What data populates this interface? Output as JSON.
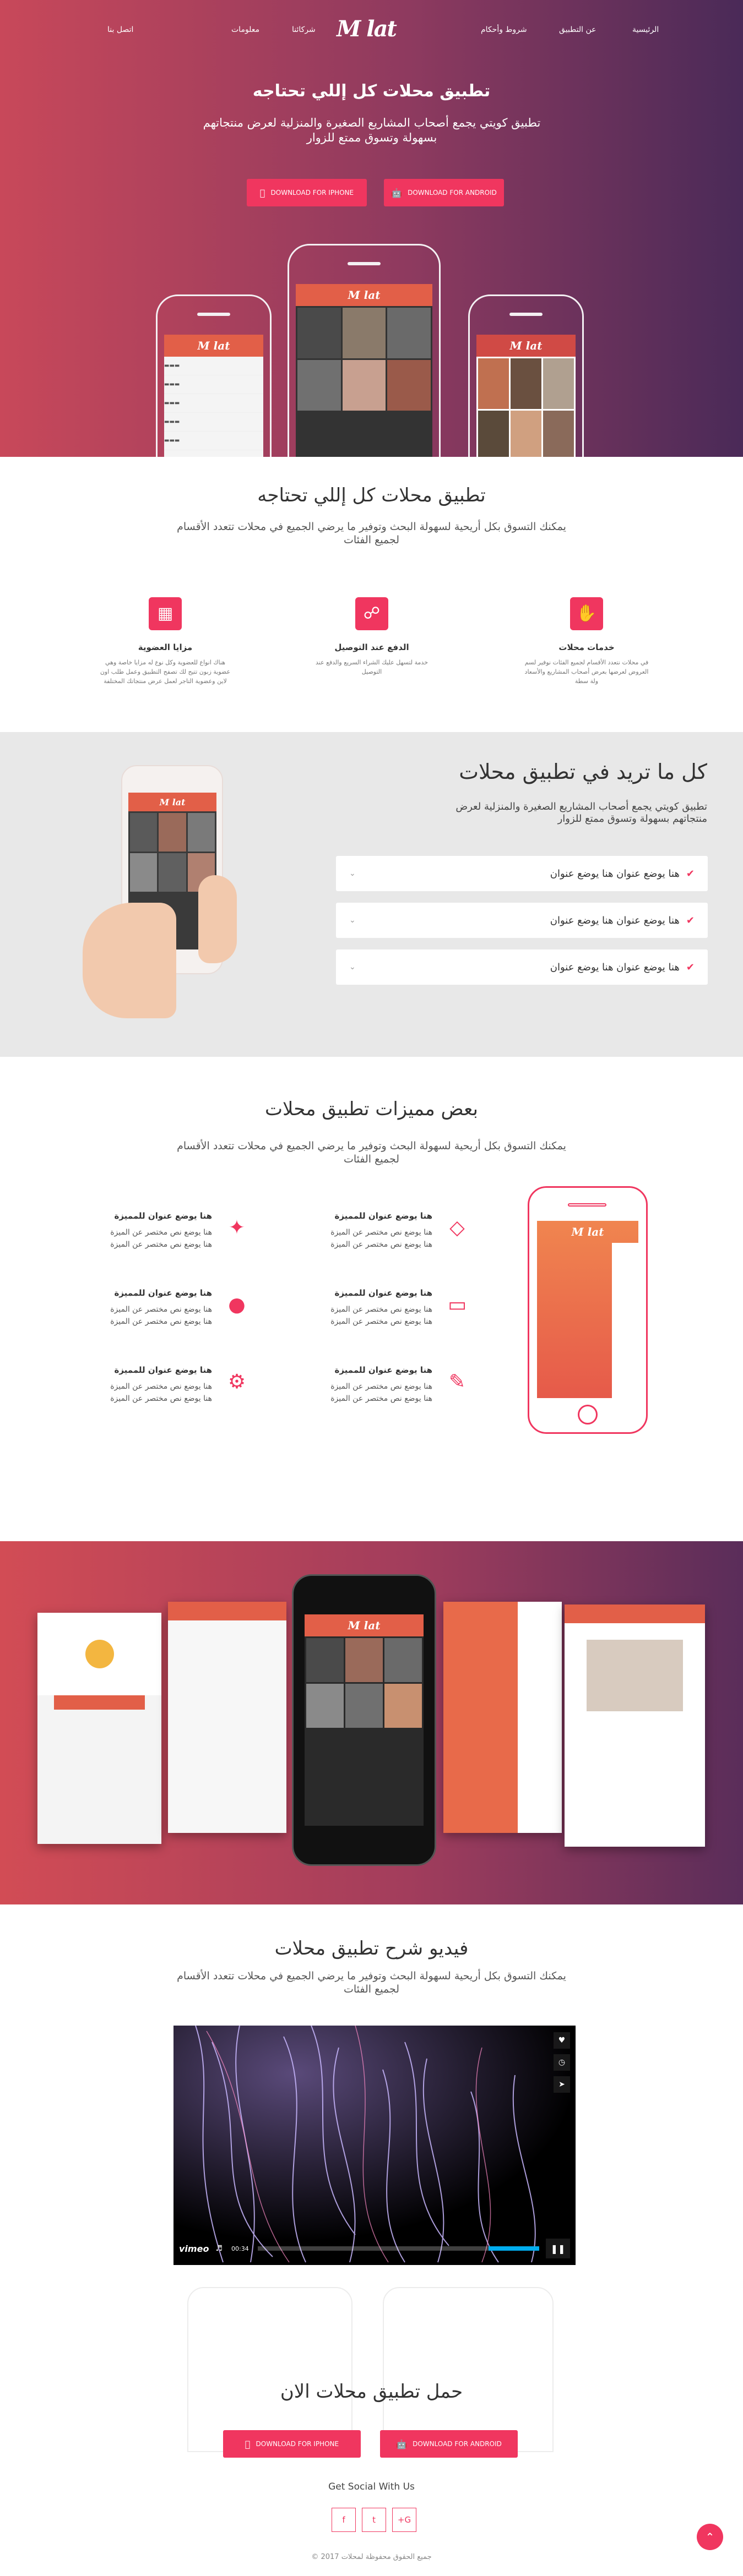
{
  "nav": {
    "logo": "M lat",
    "items": [
      "الرئيسية",
      "عن التطبيق",
      "شروط وأحكام",
      "شركائنا",
      "معلومات",
      "اتصل بنا"
    ]
  },
  "hero": {
    "title": "تطبيق محلات كل إللي تحتاجه",
    "subtitle": "تطبيق كويتي يجمع أصحاب المشاريع الصغيرة والمنزلية لعرض منتجاتهم بسهولة وتسوق ممتع للزوار",
    "btn_iphone": "DOWNLOAD FOR IPHONE",
    "btn_android": "DOWNLOAD FOR ANDROID"
  },
  "features": {
    "title": "تطبيق محلات كل إللي تحتاجه",
    "subtitle": "يمكنك التسوق بكل أريحية لسهولة البحث وتوفير ما يرضي الجميع في محلات تتعدد الأقسام لجميع الفئات",
    "items": [
      {
        "title": "خدمات محلات",
        "desc": "في محلات نتعدد الأقسام لجميع الفئات نوفير لسم العروض لعرضها بعرض أصحاب المشاريع والأسعاد ولة سطة",
        "icon": "hand-icon"
      },
      {
        "title": "الدفع عند التوصيل",
        "desc": "خدمة لتسهل عليك الشراء السريع والدفع عند التوصيل",
        "icon": "wallet-icon"
      },
      {
        "title": "مزايا العضوية",
        "desc": "هناك انواع للعضوية وكل نوع له مزايا خاصة وهي عضوية زبون تتيح لك تصفح التطبيق وعمل طلب اون لاين وعضوية التاجر لعمل عرض منتجاتك المختلفة",
        "icon": "grid-icon"
      }
    ]
  },
  "want": {
    "title": "كل ما تريد في تطبيق محلات",
    "subtitle": "تطبيق كويتي يجمع أصحاب المشاريع الصغيرة والمنزلية لعرض منتجاتهم بسهولة وتسوق ممتع للزوار",
    "accordion": [
      "هنا يوضع عنوان هنا يوضع عنوان",
      "هنا يوضع عنوان هنا يوضع عنوان",
      "هنا يوضع عنوان هنا يوضع عنوان"
    ]
  },
  "props": {
    "title": "بعض مميزات تطبيق محلات",
    "subtitle": "يمكنك التسوق بكل أريحية لسهولة البحث وتوفير ما يرضي الجميع في محلات تتعدد الأقسام لجميع الفئات",
    "items": [
      {
        "title": "هنا يوضع عنوان للمميزة",
        "desc": "هنا يوضع نص مختصر عن الميزة هنا يوضع نص مختصر عن الميزة",
        "icon": "diamond-icon"
      },
      {
        "title": "هنا يوضع عنوان للمميزة",
        "desc": "هنا يوضع نص مختصر عن الميزة هنا يوضع نص مختصر عن الميزة",
        "icon": "magic-wand-icon"
      },
      {
        "title": "هنا يوضع عنوان للمميزة",
        "desc": "هنا يوضع نص مختصر عن الميزة هنا يوضع نص مختصر عن الميزة",
        "icon": "laptop-icon"
      },
      {
        "title": "هنا يوضع عنوان للمميزة",
        "desc": "هنا يوضع نص مختصر عن الميزة هنا يوضع نص مختصر عن الميزة",
        "icon": "user-icon"
      },
      {
        "title": "هنا يوضع عنوان للمميزة",
        "desc": "هنا يوضع نص مختصر عن الميزة هنا يوضع نص مختصر عن الميزة",
        "icon": "pencil-icon"
      },
      {
        "title": "هنا يوضع عنوان للمميزة",
        "desc": "هنا يوضع نص مختصر عن الميزة هنا يوضع نص مختصر عن الميزة",
        "icon": "gear-icon"
      }
    ]
  },
  "video": {
    "title": "فيديو شرح تطبيق محلات",
    "subtitle": "يمكنك التسوق بكل أريحية لسهولة البحث وتوفير ما يرضي الجميع في محلات تتعدد الأقسام لجميع الفئات",
    "time": "00:34",
    "brand": "vimeo"
  },
  "download": {
    "title": "حمل تطبيق محلات الان",
    "btn_iphone": "DOWNLOAD FOR IPHONE",
    "btn_android": "DOWNLOAD FOR ANDROID",
    "social_title": "Get Social With Us",
    "social": [
      "f",
      "t",
      "G+"
    ],
    "copyright": "جميع الحقوق محفوظة لمحلات 2017 ©"
  },
  "colors": {
    "accent": "#f0365f",
    "app_orange": "#e25f48",
    "hero_start": "#c8485a",
    "hero_end": "#4a2a58"
  }
}
